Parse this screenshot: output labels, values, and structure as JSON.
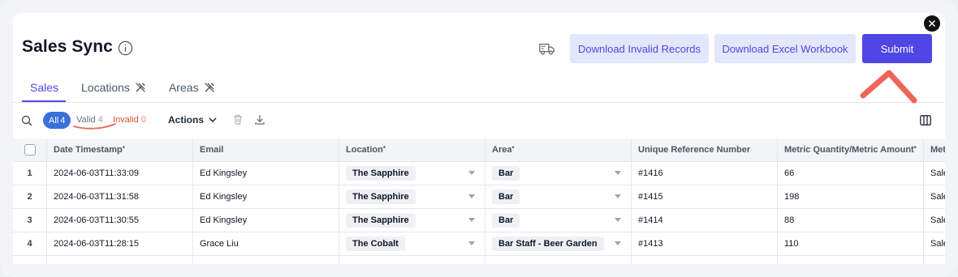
{
  "app": {
    "title": "Sales Sync"
  },
  "toolbar": {
    "download_invalid_label": "Download Invalid Records",
    "download_excel_label": "Download Excel Workbook",
    "submit_label": "Submit"
  },
  "tabs": [
    {
      "label": "Sales",
      "active": true
    },
    {
      "label": "Locations",
      "active": false
    },
    {
      "label": "Areas",
      "active": false
    }
  ],
  "filters": {
    "all_label": "All",
    "all_count": "4",
    "valid_label": "Valid",
    "valid_count": "4",
    "invalid_label": "Invalid",
    "invalid_count": "0",
    "actions_label": "Actions"
  },
  "table": {
    "columns": {
      "date": "Date Timestamp",
      "email": "Email",
      "location": "Location",
      "area": "Area",
      "ref": "Unique Reference Number",
      "qty": "Metric Quantity/Metric Amount",
      "metric": "Met"
    },
    "required_mark": "*",
    "rows": [
      {
        "idx": "1",
        "date": "2024-06-03T11:33:09",
        "email": "Ed Kingsley",
        "location": "The Sapphire",
        "area": "Bar",
        "ref": "#1416",
        "qty": "66",
        "metric": "Sale"
      },
      {
        "idx": "2",
        "date": "2024-06-03T11:31:58",
        "email": "Ed Kingsley",
        "location": "The Sapphire",
        "area": "Bar",
        "ref": "#1415",
        "qty": "198",
        "metric": "Sale"
      },
      {
        "idx": "3",
        "date": "2024-06-03T11:30:55",
        "email": "Ed Kingsley",
        "location": "The Sapphire",
        "area": "Bar",
        "ref": "#1414",
        "qty": "88",
        "metric": "Sale"
      },
      {
        "idx": "4",
        "date": "2024-06-03T11:28:15",
        "email": "Grace Liu",
        "location": "The Cobalt",
        "area": "Bar Staff - Beer Garden",
        "ref": "#1413",
        "qty": "110",
        "metric": "Sale"
      }
    ]
  },
  "colors": {
    "accent": "#4f46e5",
    "accent_soft": "#e4e6fb",
    "invalid": "#e0522f",
    "annotation": "#f0645a"
  }
}
